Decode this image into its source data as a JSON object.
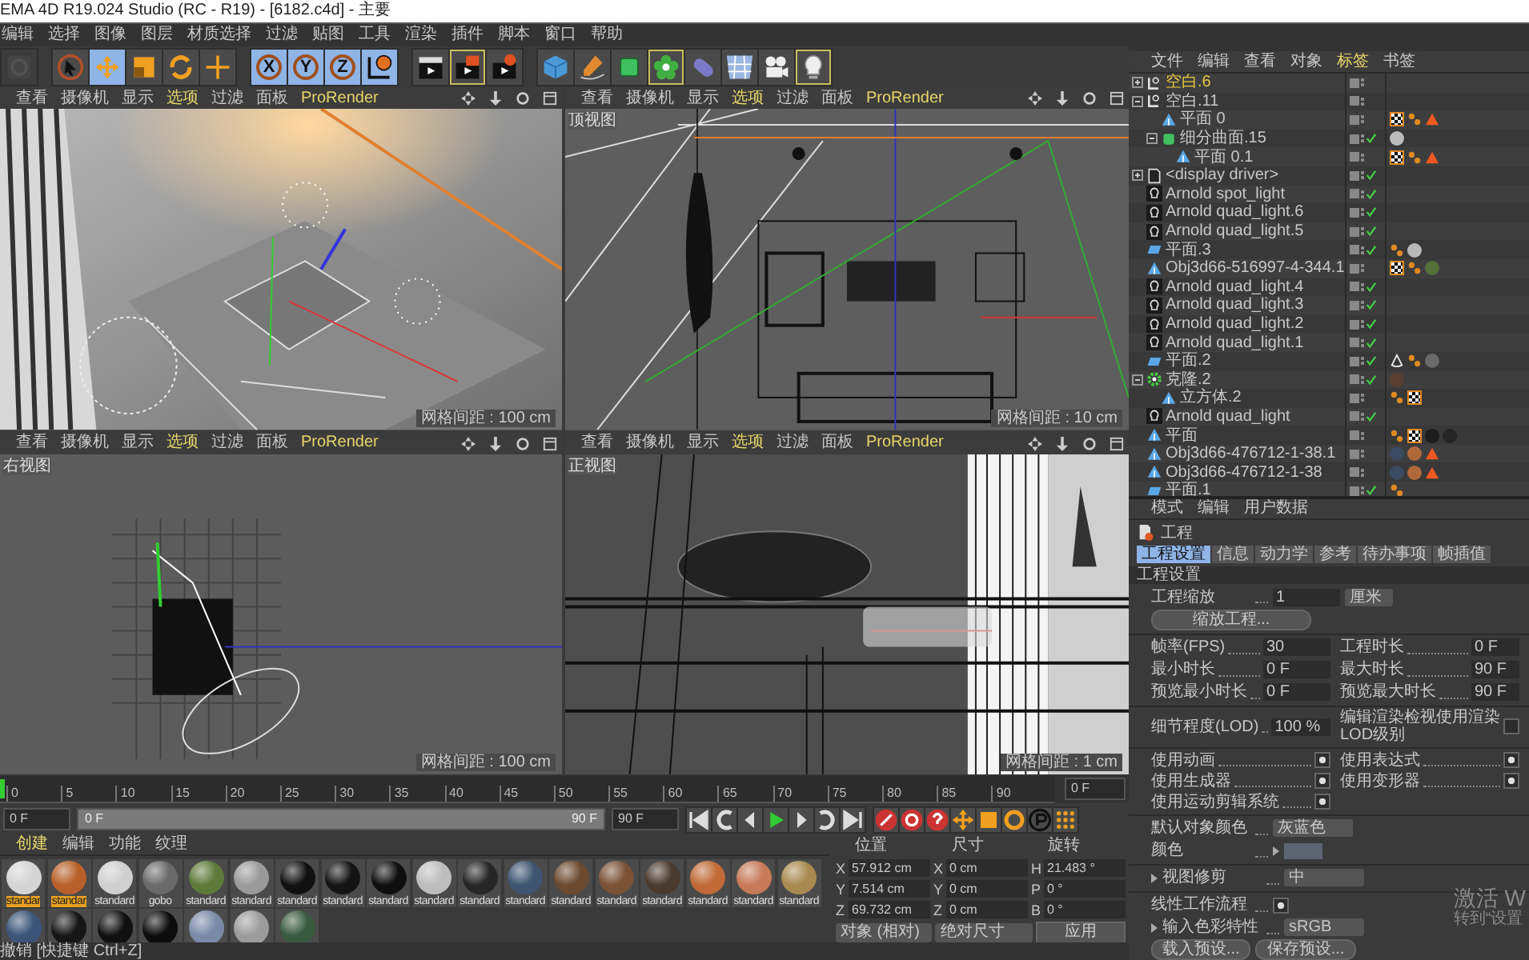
{
  "window": {
    "title": "EMA 4D R19.024 Studio (RC - R19) - [6182.c4d] - 主要"
  },
  "menu_bar": [
    "编辑",
    "选择",
    "图像",
    "图层",
    "材质选择",
    "过滤",
    "贴图",
    "工具",
    "渲染",
    "插件",
    "脚本",
    "窗口",
    "帮助"
  ],
  "toolbar": [
    [
      {
        "kind": "app-logo",
        "selected": false,
        "framed": false
      }
    ],
    [
      {
        "kind": "select-tool",
        "selected": false,
        "framed": false
      },
      {
        "kind": "move-tool",
        "selected": true,
        "framed": false
      },
      {
        "kind": "scale-tool",
        "selected": false,
        "framed": false
      },
      {
        "kind": "rotate-tool",
        "selected": false,
        "framed": false
      },
      {
        "kind": "recent-tool",
        "selected": false,
        "framed": false
      }
    ],
    [
      {
        "kind": "axis-lock",
        "label": "X",
        "selected": true,
        "framed": false
      },
      {
        "kind": "axis-lock",
        "label": "Y",
        "selected": true,
        "framed": false
      },
      {
        "kind": "axis-lock",
        "label": "Z",
        "selected": true,
        "framed": false
      },
      {
        "kind": "coordinate-system",
        "selected": true,
        "framed": false
      }
    ],
    [
      {
        "kind": "render-view",
        "selected": false,
        "framed": false
      },
      {
        "kind": "render-picture-viewer",
        "selected": false,
        "framed": true
      },
      {
        "kind": "render-settings",
        "selected": false,
        "framed": false
      }
    ],
    [
      {
        "kind": "cube-primitive",
        "selected": false,
        "framed": false
      },
      {
        "kind": "pen-spline",
        "selected": false,
        "framed": false
      },
      {
        "kind": "subdivision-surface",
        "selected": false,
        "framed": false
      },
      {
        "kind": "cloner",
        "selected": false,
        "framed": true
      },
      {
        "kind": "deformer",
        "selected": false,
        "framed": false
      },
      {
        "kind": "floor",
        "selected": false,
        "framed": false
      },
      {
        "kind": "camera",
        "selected": false,
        "framed": false
      },
      {
        "kind": "light",
        "selected": false,
        "framed": true
      }
    ]
  ],
  "viewports": [
    {
      "kind": "perspective",
      "grid": "网格间距 : 100 cm",
      "menu": [
        {
          "label": "查看",
          "accent": false
        },
        {
          "label": "摄像机",
          "accent": false
        },
        {
          "label": "显示",
          "accent": false
        },
        {
          "label": "选项",
          "accent": true
        },
        {
          "label": "过滤",
          "accent": false
        },
        {
          "label": "面板",
          "accent": false
        },
        {
          "label": "ProRender",
          "accent": true
        }
      ]
    },
    {
      "kind": "top",
      "label": "顶视图",
      "grid": "网格间距 : 10 cm",
      "menu": [
        {
          "label": "查看",
          "accent": false
        },
        {
          "label": "摄像机",
          "accent": false
        },
        {
          "label": "显示",
          "accent": false
        },
        {
          "label": "选项",
          "accent": true
        },
        {
          "label": "过滤",
          "accent": false
        },
        {
          "label": "面板",
          "accent": false
        },
        {
          "label": "ProRender",
          "accent": true
        }
      ]
    },
    {
      "kind": "right",
      "label": "右视图",
      "grid": "网格间距 : 100 cm",
      "menu": [
        {
          "label": "查看",
          "accent": false
        },
        {
          "label": "摄像机",
          "accent": false
        },
        {
          "label": "显示",
          "accent": false
        },
        {
          "label": "选项",
          "accent": true
        },
        {
          "label": "过滤",
          "accent": false
        },
        {
          "label": "面板",
          "accent": false
        },
        {
          "label": "ProRender",
          "accent": true
        }
      ]
    },
    {
      "kind": "front",
      "label": "正视图",
      "grid": "网格间距 : 1 cm",
      "menu": [
        {
          "label": "查看",
          "accent": false
        },
        {
          "label": "摄像机",
          "accent": false
        },
        {
          "label": "显示",
          "accent": false
        },
        {
          "label": "选项",
          "accent": true
        },
        {
          "label": "过滤",
          "accent": false
        },
        {
          "label": "面板",
          "accent": false
        },
        {
          "label": "ProRender",
          "accent": true
        }
      ]
    }
  ],
  "timeline": {
    "ticks": [
      "0",
      "5",
      "10",
      "15",
      "20",
      "25",
      "30",
      "35",
      "40",
      "45",
      "50",
      "55",
      "60",
      "65",
      "70",
      "75",
      "80",
      "85",
      "90"
    ],
    "frame_field": "0 F"
  },
  "playback": {
    "start_field": "0 F",
    "range_start": "0 F",
    "range_end": "90 F",
    "end_field": "90 F"
  },
  "materials": {
    "menu": [
      {
        "label": "创建",
        "accent": true
      },
      {
        "label": "编辑",
        "accent": false
      },
      {
        "label": "功能",
        "accent": false
      },
      {
        "label": "纹理",
        "accent": false
      }
    ],
    "swatches": [
      {
        "label": "standar",
        "color": "#d4d4d4",
        "selected": true
      },
      {
        "label": "standar",
        "color": "#b8602a",
        "selected": true
      },
      {
        "label": "standard",
        "color": "#cfcfcf",
        "selected": false
      },
      {
        "label": "gobo",
        "color": "#6a6a6a",
        "selected": false
      },
      {
        "label": "standard",
        "color": "#5e7a3a",
        "selected": false
      },
      {
        "label": "standard",
        "color": "#9a9a9a",
        "selected": false
      },
      {
        "label": "standard",
        "color": "#111111",
        "selected": false
      },
      {
        "label": "standard",
        "color": "#141414",
        "selected": false
      },
      {
        "label": "standard",
        "color": "#0f0f0f",
        "selected": false
      },
      {
        "label": "standard",
        "color": "#bdbdbd",
        "selected": false
      },
      {
        "label": "standard",
        "color": "#262626",
        "selected": false
      },
      {
        "label": "standard",
        "color": "#3e5470",
        "selected": false
      },
      {
        "label": "standard",
        "color": "#6b4a30",
        "selected": false
      },
      {
        "label": "standard",
        "color": "#7a5236",
        "selected": false
      },
      {
        "label": "standard",
        "color": "#4a3a2e",
        "selected": false
      },
      {
        "label": "standard",
        "color": "#c06a38",
        "selected": false
      },
      {
        "label": "standard",
        "color": "#c77a5a",
        "selected": false
      },
      {
        "label": "standard",
        "color": "#a88a50",
        "selected": false
      },
      {
        "color": "#3c5478",
        "selected": false
      },
      {
        "color": "#161616",
        "selected": false
      },
      {
        "color": "#101010",
        "selected": false
      },
      {
        "color": "#0c0c0c",
        "selected": false
      },
      {
        "color": "#7a8aa8",
        "selected": false
      },
      {
        "color": "#9c9c9c",
        "selected": false
      },
      {
        "color": "#3a5a40",
        "selected": false
      }
    ]
  },
  "coordinates": {
    "headers": [
      "位置",
      "尺寸",
      "旋转"
    ],
    "rows": [
      [
        {
          "axis": "X",
          "value": "57.912 cm"
        },
        {
          "axis": "X",
          "value": "0 cm"
        },
        {
          "axis": "H",
          "value": "21.483 °"
        }
      ],
      [
        {
          "axis": "Y",
          "value": "7.514 cm"
        },
        {
          "axis": "Y",
          "value": "0 cm"
        },
        {
          "axis": "P",
          "value": "0 °"
        }
      ],
      [
        {
          "axis": "Z",
          "value": "69.732 cm"
        },
        {
          "axis": "Z",
          "value": "0 cm"
        },
        {
          "axis": "B",
          "value": "0 °"
        }
      ]
    ],
    "mode_dropdowns": [
      "对象 (相对)",
      "绝对尺寸"
    ],
    "apply_button": "应用"
  },
  "status_bar": "撤销 [快捷键 Ctrl+Z]",
  "object_manager": {
    "menu": [
      {
        "label": "文件",
        "accent": false
      },
      {
        "label": "编辑",
        "accent": false
      },
      {
        "label": "查看",
        "accent": false
      },
      {
        "label": "对象",
        "accent": false
      },
      {
        "label": "标签",
        "accent": true
      },
      {
        "label": "书签",
        "accent": false
      }
    ],
    "objects": [
      {
        "name": "空白.6",
        "kind": "null",
        "expanded": false,
        "selected": true,
        "enabled": false
      },
      {
        "name": "空白.11",
        "kind": "null",
        "expanded": true,
        "selected": false,
        "enabled": false,
        "children": [
          {
            "name": "平面 0",
            "kind": "polygon",
            "selected": false,
            "enabled": false,
            "tags": [
              {
                "kind": "texture"
              },
              {
                "kind": "phong"
              },
              {
                "kind": "warning"
              }
            ]
          },
          {
            "name": "细分曲面.15",
            "kind": "subdivision",
            "expanded": true,
            "selected": false,
            "enabled": true,
            "tags": [
              {
                "kind": "material",
                "color": "#bcbcbc"
              }
            ],
            "children": [
              {
                "name": "平面 0.1",
                "kind": "polygon",
                "selected": false,
                "enabled": false,
                "tags": [
                  {
                    "kind": "texture"
                  },
                  {
                    "kind": "phong"
                  },
                  {
                    "kind": "warning"
                  }
                ]
              }
            ]
          }
        ]
      },
      {
        "name": "<display driver>",
        "kind": "document",
        "expanded": false,
        "selected": false,
        "enabled": true
      },
      {
        "name": "Arnold spot_light",
        "kind": "light",
        "selected": false,
        "enabled": true
      },
      {
        "name": "Arnold quad_light.6",
        "kind": "light",
        "selected": false,
        "enabled": true
      },
      {
        "name": "Arnold quad_light.5",
        "kind": "light",
        "selected": false,
        "enabled": true
      },
      {
        "name": "平面.3",
        "kind": "plane",
        "selected": false,
        "enabled": true,
        "tags": [
          {
            "kind": "phong"
          },
          {
            "kind": "material",
            "color": "#b8b8b8"
          }
        ]
      },
      {
        "name": "Obj3d66-516997-4-344.1",
        "kind": "polygon",
        "selected": false,
        "enabled": false,
        "tags": [
          {
            "kind": "texture"
          },
          {
            "kind": "phong"
          },
          {
            "kind": "material",
            "color": "#55703a"
          }
        ]
      },
      {
        "name": "Arnold quad_light.4",
        "kind": "light",
        "selected": false,
        "enabled": true
      },
      {
        "name": "Arnold quad_light.3",
        "kind": "light",
        "selected": false,
        "enabled": true
      },
      {
        "name": "Arnold quad_light.2",
        "kind": "light",
        "selected": false,
        "enabled": true
      },
      {
        "name": "Arnold quad_light.1",
        "kind": "light",
        "selected": false,
        "enabled": true
      },
      {
        "name": "平面.2",
        "kind": "plane",
        "selected": false,
        "enabled": true,
        "tags": [
          {
            "kind": "cone"
          },
          {
            "kind": "phong"
          },
          {
            "kind": "material",
            "color": "#6a6a6a"
          }
        ]
      },
      {
        "name": "克隆.2",
        "kind": "cloner",
        "expanded": true,
        "selected": false,
        "enabled": true,
        "tags": [
          {
            "kind": "material",
            "color": "#5a4030"
          }
        ],
        "children": [
          {
            "name": "立方体.2",
            "kind": "polygon",
            "selected": false,
            "enabled": false,
            "tags": [
              {
                "kind": "phong"
              },
              {
                "kind": "texture"
              }
            ]
          }
        ]
      },
      {
        "name": "Arnold quad_light",
        "kind": "light",
        "selected": false,
        "enabled": true
      },
      {
        "name": "平面",
        "kind": "polygon",
        "selected": false,
        "enabled": false,
        "tags": [
          {
            "kind": "phong"
          },
          {
            "kind": "texture"
          },
          {
            "kind": "material",
            "color": "#1c1c1c"
          },
          {
            "kind": "material",
            "color": "#262626"
          }
        ]
      },
      {
        "name": "Obj3d66-476712-1-38.1",
        "kind": "polygon",
        "selected": false,
        "enabled": false,
        "tags": [
          {
            "kind": "material",
            "color": "#3a4a60"
          },
          {
            "kind": "material",
            "color": "#b06a3a"
          },
          {
            "kind": "warning"
          }
        ]
      },
      {
        "name": "Obj3d66-476712-1-38",
        "kind": "polygon",
        "selected": false,
        "enabled": false,
        "tags": [
          {
            "kind": "material",
            "color": "#3a4a60"
          },
          {
            "kind": "material",
            "color": "#b06a3a"
          },
          {
            "kind": "warning"
          }
        ]
      },
      {
        "name": "平面.1",
        "kind": "plane",
        "selected": false,
        "enabled": true,
        "tags": [
          {
            "kind": "phong"
          }
        ]
      }
    ]
  },
  "attributes": {
    "menu": [
      "模式",
      "编辑",
      "用户数据"
    ],
    "object_title": "工程",
    "tabs": [
      {
        "label": "工程设置",
        "selected": true
      },
      {
        "label": "信息",
        "selected": false
      },
      {
        "label": "动力学",
        "selected": false
      },
      {
        "label": "参考",
        "selected": false
      },
      {
        "label": "待办事项",
        "selected": false
      },
      {
        "label": "帧插值",
        "selected": false
      }
    ],
    "section": "工程设置",
    "scale": {
      "label": "工程缩放",
      "value": "1",
      "unit": "厘米"
    },
    "scale_button": "缩放工程...",
    "time_rows": [
      {
        "left": {
          "label": "帧率(FPS)",
          "value": "30"
        },
        "right": {
          "label": "工程时长",
          "value": "0 F"
        }
      },
      {
        "left": {
          "label": "最小时长",
          "value": "0 F"
        },
        "right": {
          "label": "最大时长",
          "value": "90 F"
        }
      },
      {
        "left": {
          "label": "预览最小时长",
          "value": "0 F"
        },
        "right": {
          "label": "预览最大时长",
          "value": "90 F"
        }
      }
    ],
    "lod": {
      "label": "细节程度(LOD)",
      "value": "100 %",
      "option": {
        "label": "编辑渲染检视使用渲染LOD级别",
        "checked": false
      }
    },
    "checks": [
      {
        "label": "使用动画",
        "checked": true
      },
      {
        "label": "使用表达式",
        "checked": true
      },
      {
        "label": "使用生成器",
        "checked": true
      },
      {
        "label": "使用变形器",
        "checked": true
      },
      {
        "label": "使用运动剪辑系统",
        "checked": true
      }
    ],
    "default_color": {
      "label": "默认对象颜色",
      "value": "灰蓝色"
    },
    "color": {
      "label": "颜色",
      "color": "#5c6470"
    },
    "view_clip": {
      "label": "视图修剪",
      "value": "中"
    },
    "linear_workflow": {
      "label": "线性工作流程",
      "checked": true
    },
    "input_color_profile": {
      "label": "输入色彩特性",
      "value": "sRGB"
    },
    "buttons": [
      "载入预设...",
      "保存预设..."
    ],
    "os_notice": [
      "激活 W",
      "转到“设置"
    ]
  }
}
